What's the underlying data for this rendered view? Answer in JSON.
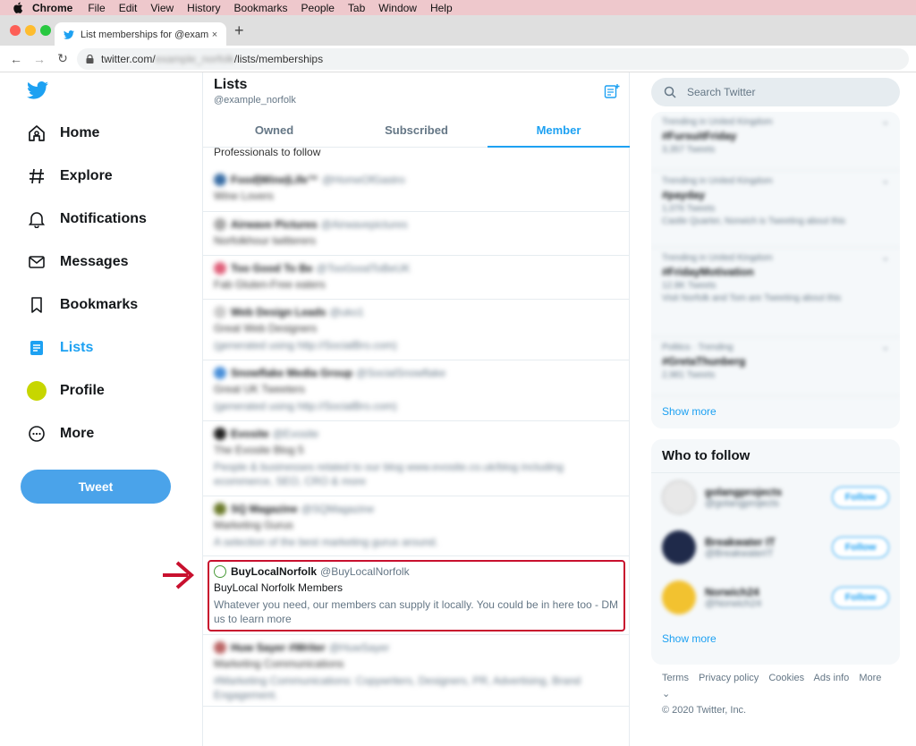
{
  "menubar": {
    "items": [
      "Chrome",
      "File",
      "Edit",
      "View",
      "History",
      "Bookmarks",
      "People",
      "Tab",
      "Window",
      "Help"
    ]
  },
  "browser": {
    "tab_title": "List memberships for @example_norfolk",
    "url_prefix": "twitter.com/",
    "url_blurred": "example_norfolk",
    "url_suffix": "/lists/memberships",
    "close_glyph": "×",
    "newtab_glyph": "+",
    "back_glyph": "←",
    "forward_glyph": "→",
    "reload_glyph": "↻"
  },
  "sidebar": {
    "nav": [
      {
        "label": "Home",
        "icon": "home-icon"
      },
      {
        "label": "Explore",
        "icon": "hash-icon"
      },
      {
        "label": "Notifications",
        "icon": "bell-icon"
      },
      {
        "label": "Messages",
        "icon": "envelope-icon"
      },
      {
        "label": "Bookmarks",
        "icon": "bookmark-icon"
      },
      {
        "label": "Lists",
        "icon": "list-icon",
        "active": true
      },
      {
        "label": "Profile",
        "icon": "avatar"
      },
      {
        "label": "More",
        "icon": "more-icon"
      }
    ],
    "tweet_label": "Tweet",
    "accent": "#1da1f2"
  },
  "main": {
    "title": "Lists",
    "handle": "@example_norfolk",
    "tabs": [
      "Owned",
      "Subscribed",
      "Member"
    ],
    "active_tab": "Member",
    "top_text": "Professionals to follow",
    "lists": [
      {
        "name": "Food|Wine|Life™",
        "handle": "@HomeOfGastro",
        "list": "Wine Lovers",
        "desc": ""
      },
      {
        "name": "Airwave Pictures",
        "handle": "@Airwavepictures",
        "list": "Norfolkhour twitterers",
        "desc": ""
      },
      {
        "name": "Too Good To Be",
        "handle": "@TooGoodToBeUK",
        "list": "Fab Gluten-Free eaters",
        "desc": ""
      },
      {
        "name": "Web Design Leads",
        "handle": "@uko1",
        "list": "Great Web Designers",
        "desc": "(generated using http://SocialBro.com)"
      },
      {
        "name": "Snowflake Media Group",
        "handle": "@SocialSnowflake",
        "list": "Great UK Tweeters",
        "desc": "(generated using http://SocialBro.com)"
      },
      {
        "name": "Evosite",
        "handle": "@Evosite",
        "list": "The Evosite Blog 5",
        "desc": "People & businesses related to our blog www.evosite.co.uk/blog including ecommerce, SEO, CRO & more"
      },
      {
        "name": "SQ Magazine",
        "handle": "@SQMagazine",
        "list": "Marketing Gurus",
        "desc": "A selection of the best marketing gurus around."
      },
      {
        "name": "BuyLocalNorfolk",
        "handle": "@BuyLocalNorfolk",
        "list": "BuyLocal Norfolk Members",
        "desc": "Whatever you need, our members can supply it locally. You could be in here too - DM us to learn more"
      },
      {
        "name": "Huw Sayer #Writer",
        "handle": "@HuwSayer",
        "list": "Marketing Communications",
        "desc": "#Marketing Communications: Copywriters, Designers, PR, Advertising, Brand Engagement."
      }
    ]
  },
  "right": {
    "search_placeholder": "Search Twitter",
    "trends": [
      {
        "context": "Trending in United Kingdom",
        "name": "#FursuitFriday",
        "count": "3,357 Tweets",
        "extra": ""
      },
      {
        "context": "Trending in United Kingdom",
        "name": "#payday",
        "count": "1,076 Tweets",
        "extra": "Castle Quarter, Norwich is Tweeting about this"
      },
      {
        "context": "Trending in United Kingdom",
        "name": "#FridayMotivation",
        "count": "12.8K Tweets",
        "extra": "Visit Norfolk and Tom are Tweeting about this"
      },
      {
        "context": "Politics · Trending",
        "name": "#GretaThunberg",
        "count": "2,981 Tweets",
        "extra": ""
      }
    ],
    "trends_show_more": "Show more",
    "who_title": "Who to follow",
    "who": [
      {
        "name": "golangprojects",
        "handle": "@golangprojects",
        "button": "Follow"
      },
      {
        "name": "Breakwater IT",
        "handle": "@BreakwaterIT",
        "button": "Follow"
      },
      {
        "name": "Norwich24",
        "handle": "@Norwich24",
        "button": "Follow"
      }
    ],
    "who_show_more": "Show more",
    "footer_links": [
      "Terms",
      "Privacy policy",
      "Cookies",
      "Ads info",
      "More ⌄"
    ],
    "copyright": "© 2020 Twitter, Inc."
  }
}
